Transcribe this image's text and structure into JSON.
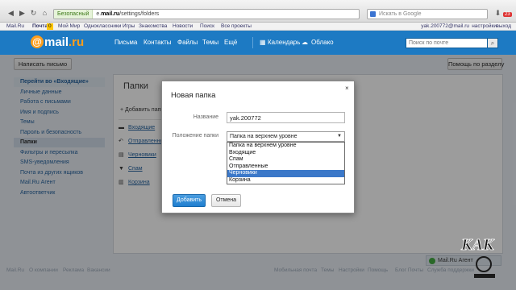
{
  "browser": {
    "secure_label": "Безопасный",
    "url_prefix": "e.",
    "url_domain": "mail.ru",
    "url_path": "/settings/folders",
    "search_engine_placeholder": "Искать в Google",
    "tab_badge": "23"
  },
  "topstrip": {
    "items": [
      "Mail.Ru",
      "Почта",
      "Мой Мир",
      "Одноклассники",
      "Игры",
      "Знакомства",
      "Новости",
      "Поиск",
      "Все проекты"
    ],
    "mail_badge": "0",
    "account": "yak.200772@mail.ru",
    "settings": "настройки",
    "logout": "выход"
  },
  "header": {
    "logo_at": "@",
    "logo_mail": "mail",
    "logo_ru": ".ru",
    "nav": [
      "Письма",
      "Контакты",
      "Файлы",
      "Темы",
      "Ещё",
      "Календарь",
      "Облако"
    ],
    "search_placeholder": "Поиск по почте"
  },
  "toolbar": {
    "compose_label": "Написать письмо",
    "help_label": "Помощь по разделу"
  },
  "sidebar": {
    "items": [
      "Перейти во «Входящие»",
      "Личные данные",
      "Работа с письмами",
      "Имя и подпись",
      "Темы",
      "Пароль и безопасность",
      "Папки",
      "Фильтры и пересылка",
      "SMS-уведомления",
      "Почта из других ящиков",
      "Mail.Ru Агент",
      "Автоответчик"
    ],
    "active_index": 6
  },
  "main": {
    "title": "Папки",
    "add_folder": "Добавить папку",
    "folders": [
      "Входящие",
      "Отправленные",
      "Черновики",
      "Спам",
      "Корзина"
    ]
  },
  "modal": {
    "title": "Новая папка",
    "close": "×",
    "name_label": "Название",
    "name_value": "yak.200772",
    "position_label": "Положение папки",
    "position_value": "Папка на верхнем уровне",
    "options": [
      "Папка на верхнем уровне",
      "Входящие",
      "Спам",
      "Отправленные",
      "Черновики",
      "Корзина"
    ],
    "highlighted_index": 4,
    "add_button": "Добавить",
    "cancel_button": "Отмена"
  },
  "footer": {
    "links": [
      "Mail.Ru",
      "О компании",
      "Реклама",
      "Вакансии",
      "Мобильная почта",
      "Темы",
      "Настройки",
      "Помощь",
      "Блог Почты",
      "Служба поддержки"
    ],
    "agent_label": "Mail.Ru Агент"
  },
  "watermark": {
    "text": "КАК"
  }
}
